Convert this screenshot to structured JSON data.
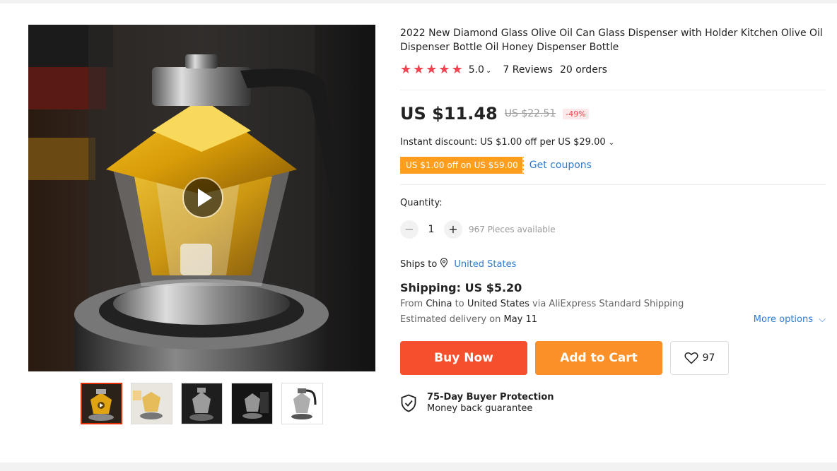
{
  "product": {
    "title": "2022 New Diamond Glass Olive Oil Can Glass Dispenser with Holder Kitchen Olive Oil Dispenser Bottle Oil Honey Dispenser Bottle",
    "rating": "5.0",
    "rating_stars": 5,
    "reviews": "7 Reviews",
    "orders": "20 orders"
  },
  "price": {
    "current": "US $11.48",
    "original": "US $22.51",
    "discount": "-49%"
  },
  "promo": {
    "instant_discount": "Instant discount: US $1.00 off per US $29.00",
    "coupon": "US $1.00 off on US $59.00",
    "get_coupons": "Get coupons"
  },
  "quantity": {
    "label": "Quantity:",
    "value": "1",
    "available": "967 Pieces available",
    "minus": "−",
    "plus": "+"
  },
  "shipping": {
    "ships_to_label": "Ships to",
    "ships_to_country": "United States",
    "cost": "Shipping: US $5.20",
    "from_prefix": "From",
    "from_country": "China",
    "to_word": "to",
    "to_country": "United States",
    "method": "via AliExpress Standard Shipping",
    "delivery_prefix": "Estimated delivery on",
    "delivery_date": "May 11",
    "more_options": "More options"
  },
  "actions": {
    "buy_now": "Buy Now",
    "add_to_cart": "Add to Cart",
    "wishlist_count": "97"
  },
  "protection": {
    "title": "75-Day Buyer Protection",
    "subtitle": "Money back guarantee"
  },
  "gallery": {
    "thumbnail_count": 5,
    "active_index": 0
  },
  "colors": {
    "accent_red": "#f44250",
    "buy_now": "#f5502e",
    "add_to_cart": "#fb9028",
    "link_blue": "#2e7bd1",
    "coupon_orange": "#fe9e1c"
  }
}
